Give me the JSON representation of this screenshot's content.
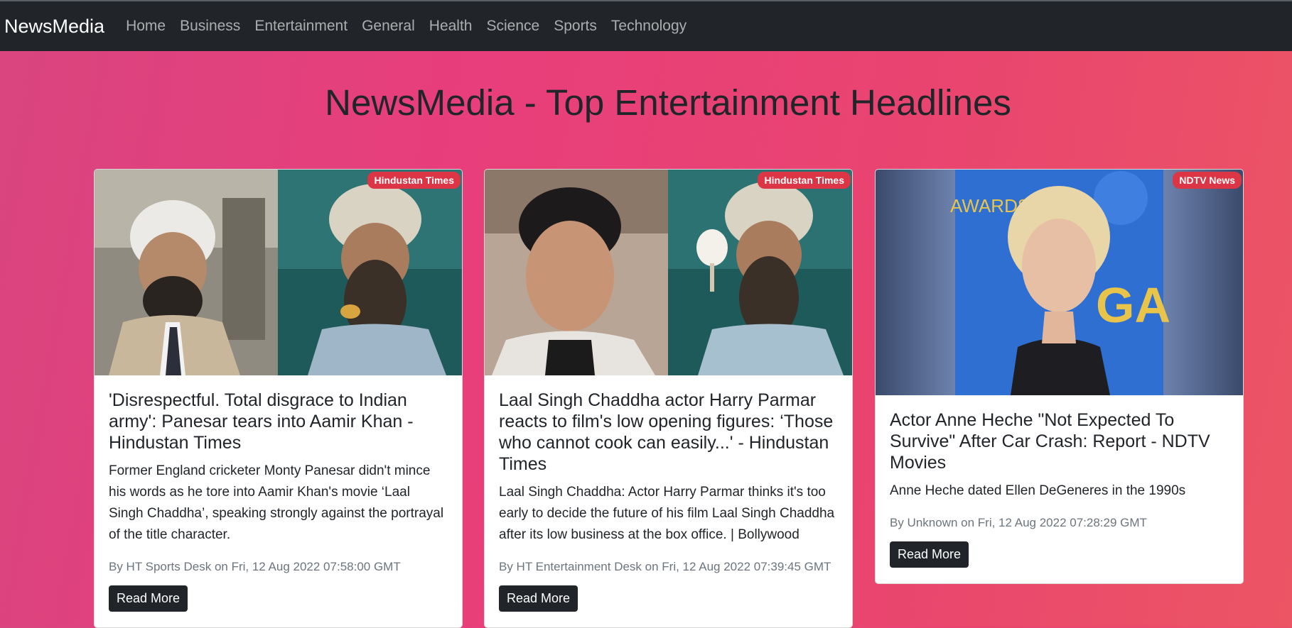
{
  "nav": {
    "brand": "NewsMedia",
    "links": [
      "Home",
      "Business",
      "Entertainment",
      "General",
      "Health",
      "Science",
      "Sports",
      "Technology"
    ]
  },
  "page": {
    "title": "NewsMedia - Top Entertainment Headlines"
  },
  "cards": [
    {
      "source": "Hindustan Times",
      "title": "'Disrespectful. Total disgrace to Indian army': Panesar tears into Aamir Khan - Hindustan Times",
      "description": "Former England cricketer Monty Panesar didn't mince his words as he tore into Aamir Khan's movie ‘Laal Singh Chaddha’, speaking strongly against the portrayal of the title character.",
      "meta": "By HT Sports Desk on Fri, 12 Aug 2022 07:58:00 GMT",
      "button": "Read More"
    },
    {
      "source": "Hindustan Times",
      "title": "Laal Singh Chaddha actor Harry Parmar reacts to film's low opening figures: ‘Those who cannot cook can easily...' - Hindustan Times",
      "description": "Laal Singh Chaddha: Actor Harry Parmar thinks it's too early to decide the future of his film Laal Singh Chaddha after its low business at the box office. | Bollywood",
      "meta": "By HT Entertainment Desk on Fri, 12 Aug 2022 07:39:45 GMT",
      "button": "Read More"
    },
    {
      "source": "NDTV News",
      "title": "Actor Anne Heche \"Not Expected To Survive\" After Car Crash: Report - NDTV Movies",
      "description": "Anne Heche dated Ellen DeGeneres in the 1990s",
      "meta": "By Unknown on Fri, 12 Aug 2022 07:28:29 GMT",
      "button": "Read More"
    }
  ],
  "colors": {
    "navbar": "#212529",
    "badge": "#dc3545",
    "background_gradient": [
      "#d9457f",
      "#ec5564"
    ]
  }
}
